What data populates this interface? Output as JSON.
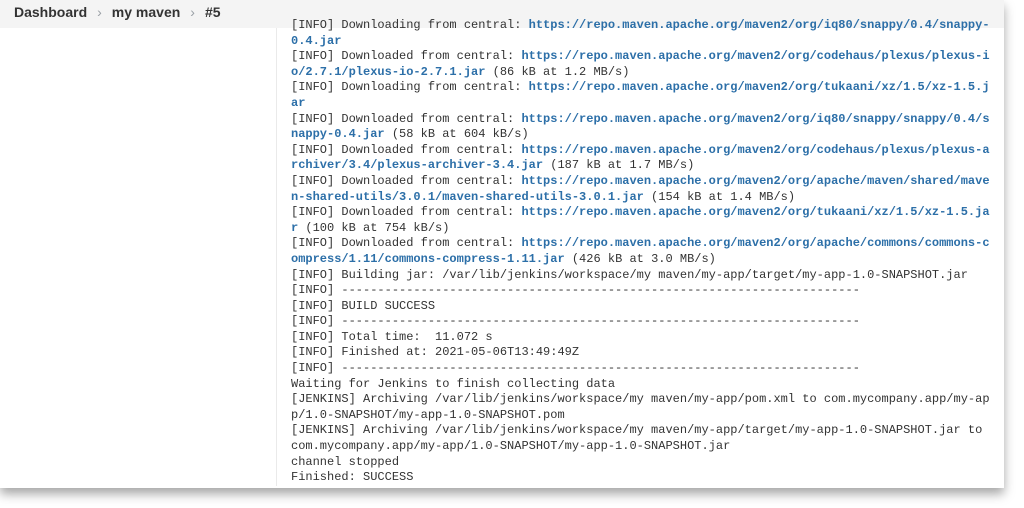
{
  "breadcrumb": [
    {
      "label": "Dashboard"
    },
    {
      "label": "my maven"
    },
    {
      "label": "#5"
    }
  ],
  "consoleLines": [
    [
      {
        "t": "[INFO] Downloading from central: "
      },
      {
        "t": "https://repo.maven.apache.org/maven2/org/iq80/snappy/0.4/snappy-0.4.jar",
        "link": true
      }
    ],
    [
      {
        "t": "[INFO] Downloaded from central: "
      },
      {
        "t": "https://repo.maven.apache.org/maven2/org/codehaus/plexus/plexus-io/2.7.1/plexus-io-2.7.1.jar",
        "link": true
      },
      {
        "t": " (86 kB at 1.2 MB/s)"
      }
    ],
    [
      {
        "t": "[INFO] Downloading from central: "
      },
      {
        "t": "https://repo.maven.apache.org/maven2/org/tukaani/xz/1.5/xz-1.5.jar",
        "link": true
      }
    ],
    [
      {
        "t": "[INFO] Downloaded from central: "
      },
      {
        "t": "https://repo.maven.apache.org/maven2/org/iq80/snappy/snappy/0.4/snappy-0.4.jar",
        "link": true
      },
      {
        "t": " (58 kB at 604 kB/s)"
      }
    ],
    [
      {
        "t": "[INFO] Downloaded from central: "
      },
      {
        "t": "https://repo.maven.apache.org/maven2/org/codehaus/plexus/plexus-archiver/3.4/plexus-archiver-3.4.jar",
        "link": true
      },
      {
        "t": " (187 kB at 1.7 MB/s)"
      }
    ],
    [
      {
        "t": "[INFO] Downloaded from central: "
      },
      {
        "t": "https://repo.maven.apache.org/maven2/org/apache/maven/shared/maven-shared-utils/3.0.1/maven-shared-utils-3.0.1.jar",
        "link": true
      },
      {
        "t": " (154 kB at 1.4 MB/s)"
      }
    ],
    [
      {
        "t": "[INFO] Downloaded from central: "
      },
      {
        "t": "https://repo.maven.apache.org/maven2/org/tukaani/xz/1.5/xz-1.5.jar",
        "link": true
      },
      {
        "t": " (100 kB at 754 kB/s)"
      }
    ],
    [
      {
        "t": "[INFO] Downloaded from central: "
      },
      {
        "t": "https://repo.maven.apache.org/maven2/org/apache/commons/commons-compress/1.11/commons-compress-1.11.jar",
        "link": true
      },
      {
        "t": " (426 kB at 3.0 MB/s)"
      }
    ],
    [
      {
        "t": "[INFO] Building jar: /var/lib/jenkins/workspace/my maven/my-app/target/my-app-1.0-SNAPSHOT.jar"
      }
    ],
    [
      {
        "t": "[INFO] ------------------------------------------------------------------------"
      }
    ],
    [
      {
        "t": "[INFO] BUILD SUCCESS"
      }
    ],
    [
      {
        "t": "[INFO] ------------------------------------------------------------------------"
      }
    ],
    [
      {
        "t": "[INFO] Total time:  11.072 s"
      }
    ],
    [
      {
        "t": "[INFO] Finished at: 2021-05-06T13:49:49Z"
      }
    ],
    [
      {
        "t": "[INFO] ------------------------------------------------------------------------"
      }
    ],
    [
      {
        "t": "Waiting for Jenkins to finish collecting data"
      }
    ],
    [
      {
        "t": "[JENKINS] Archiving /var/lib/jenkins/workspace/my maven/my-app/pom.xml to com.mycompany.app/my-app/1.0-SNAPSHOT/my-app-1.0-SNAPSHOT.pom"
      }
    ],
    [
      {
        "t": "[JENKINS] Archiving /var/lib/jenkins/workspace/my maven/my-app/target/my-app-1.0-SNAPSHOT.jar to com.mycompany.app/my-app/1.0-SNAPSHOT/my-app-1.0-SNAPSHOT.jar"
      }
    ],
    [
      {
        "t": "channel stopped"
      }
    ],
    [
      {
        "t": "Finished: SUCCESS"
      }
    ]
  ]
}
